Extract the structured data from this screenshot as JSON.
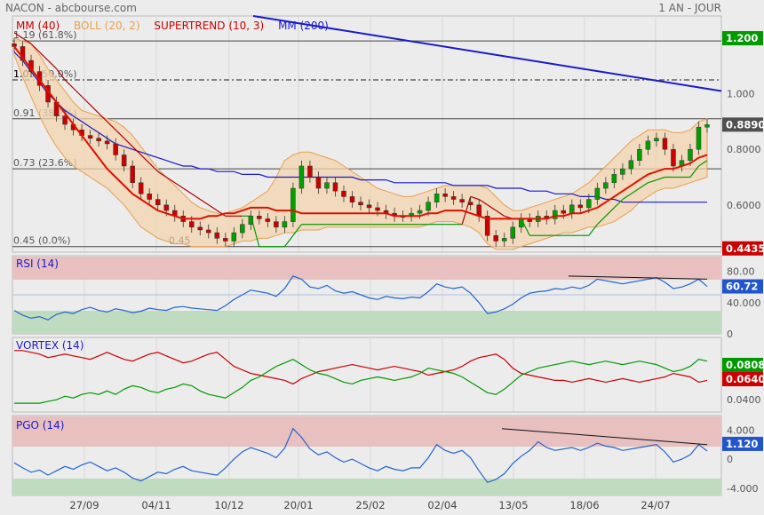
{
  "header": {
    "left": "NACON - abcbourse.com",
    "right": "1 AN - JOUR"
  },
  "legend": [
    {
      "label": "MM (40)",
      "color": "#cc0000"
    },
    {
      "label": "BOLL (20, 2)",
      "color": "#e8a050"
    },
    {
      "label": "SUPERTREND (10, 3)",
      "color": "#cc0000"
    },
    {
      "label": "MM (200)",
      "color": "#1a1acc"
    }
  ],
  "x_tick_labels": [
    "27/09",
    "04/11",
    "10/12",
    "20/01",
    "25/02",
    "02/04",
    "13/05",
    "18/06",
    "24/07"
  ],
  "main_panel": {
    "fib_levels": [
      {
        "label": "1.19  (61.8%)",
        "value": 1.19
      },
      {
        "label": "1.05  (50.0%)",
        "value": 1.05
      },
      {
        "label": "0.91  (38.2%)",
        "value": 0.91
      },
      {
        "label": "0.73  (23.6%)",
        "value": 0.73
      },
      {
        "label": "0.45  (0.0%)",
        "value": 0.45
      }
    ],
    "annotations": [
      {
        "text": "1.05",
        "x": 3,
        "y": 1.05
      },
      {
        "text": "0.45",
        "x": 60,
        "y": 0.45
      }
    ],
    "y_ticks": [
      "1.000",
      "0.8000",
      "0.6000"
    ],
    "badges": [
      {
        "text": "1.200",
        "value": 1.2,
        "color": "#009900"
      },
      {
        "text": "0.8890",
        "value": 0.889,
        "color": "#505050"
      },
      {
        "text": "0.4435",
        "value": 0.4435,
        "color": "#cc0000"
      }
    ]
  },
  "rsi_panel": {
    "title": "RSI (14)",
    "y_ticks": [
      "80.00",
      "40.000",
      "0"
    ],
    "badge": "60.72",
    "badge_color": "#2255cc"
  },
  "vortex_panel": {
    "title": "VORTEX (14)",
    "y_ticks": [
      "0.0400"
    ],
    "badges": [
      {
        "text": "0.0808",
        "color": "#009900"
      },
      {
        "text": "0.0640",
        "color": "#cc0000"
      }
    ]
  },
  "pgo_panel": {
    "title": "PGO (14)",
    "y_ticks": [
      "4.000",
      "0",
      "-4.000"
    ],
    "badge": "1.120",
    "badge_color": "#2255cc"
  },
  "colors": {
    "price_up": "#00a000",
    "price_down": "#cc0000",
    "ma40": "#dd1100",
    "ma200": "#1a1acc",
    "bollinger": "#e8a050",
    "rsi": "#2266cc",
    "zone_high": "#e8c0c0",
    "zone_low": "#c0dcc0"
  },
  "chart_data": [
    {
      "type": "candlestick",
      "title": "NACON",
      "x_tick_labels": [
        "27/09",
        "04/11",
        "10/12",
        "20/01",
        "25/02",
        "02/04",
        "13/05",
        "18/06",
        "24/07"
      ],
      "ylim": [
        0.43,
        1.28
      ],
      "series": [
        {
          "name": "NACON",
          "kind": "close",
          "values": [
            1.17,
            1.12,
            1.08,
            1.03,
            0.97,
            0.92,
            0.89,
            0.87,
            0.85,
            0.84,
            0.83,
            0.82,
            0.78,
            0.74,
            0.68,
            0.64,
            0.62,
            0.6,
            0.58,
            0.56,
            0.54,
            0.52,
            0.51,
            0.5,
            0.48,
            0.47,
            0.5,
            0.53,
            0.56,
            0.55,
            0.54,
            0.52,
            0.54,
            0.66,
            0.74,
            0.7,
            0.66,
            0.68,
            0.65,
            0.63,
            0.61,
            0.6,
            0.59,
            0.58,
            0.57,
            0.56,
            0.56,
            0.57,
            0.58,
            0.61,
            0.64,
            0.63,
            0.62,
            0.61,
            0.6,
            0.56,
            0.49,
            0.47,
            0.48,
            0.52,
            0.55,
            0.54,
            0.56,
            0.55,
            0.58,
            0.57,
            0.6,
            0.59,
            0.62,
            0.66,
            0.68,
            0.71,
            0.73,
            0.76,
            0.8,
            0.83,
            0.84,
            0.8,
            0.74,
            0.76,
            0.8,
            0.88,
            0.889
          ]
        },
        {
          "name": "MM (40)",
          "values": [
            1.17,
            1.13,
            1.09,
            1.05,
            1.01,
            0.97,
            0.93,
            0.89,
            0.85,
            0.81,
            0.77,
            0.73,
            0.7,
            0.67,
            0.64,
            0.62,
            0.6,
            0.58,
            0.57,
            0.56,
            0.55,
            0.55,
            0.55,
            0.56,
            0.56,
            0.57,
            0.57,
            0.58,
            0.59,
            0.59,
            0.59,
            0.58,
            0.58,
            0.58,
            0.57,
            0.57,
            0.57,
            0.57,
            0.57,
            0.57,
            0.57,
            0.57,
            0.57,
            0.57,
            0.57,
            0.56,
            0.56,
            0.56,
            0.56,
            0.57,
            0.57,
            0.58,
            0.58,
            0.58,
            0.57,
            0.56,
            0.55,
            0.55,
            0.55,
            0.55,
            0.55,
            0.55,
            0.55,
            0.55,
            0.56,
            0.56,
            0.57,
            0.57,
            0.58,
            0.59,
            0.61,
            0.63,
            0.65,
            0.67,
            0.69,
            0.71,
            0.72,
            0.73,
            0.73,
            0.74,
            0.75,
            0.77,
            0.78
          ]
        },
        {
          "name": "MM (200)",
          "values": [
            1.15,
            1.12,
            1.08,
            1.04,
            1.0,
            0.97,
            0.94,
            0.92,
            0.9,
            0.88,
            0.86,
            0.84,
            0.82,
            0.81,
            0.8,
            0.79,
            0.78,
            0.77,
            0.76,
            0.75,
            0.74,
            0.74,
            0.73,
            0.73,
            0.72,
            0.72,
            0.72,
            0.71,
            0.71,
            0.71,
            0.7,
            0.7,
            0.7,
            0.7,
            0.7,
            0.7,
            0.7,
            0.7,
            0.7,
            0.7,
            0.7,
            0.69,
            0.69,
            0.69,
            0.69,
            0.68,
            0.68,
            0.68,
            0.68,
            0.68,
            0.68,
            0.68,
            0.67,
            0.67,
            0.67,
            0.67,
            0.67,
            0.66,
            0.66,
            0.66,
            0.66,
            0.65,
            0.65,
            0.65,
            0.64,
            0.64,
            0.64,
            0.63,
            0.63,
            0.63,
            0.62,
            0.62,
            0.61,
            0.61,
            0.61,
            0.61,
            0.61,
            0.61,
            0.61,
            0.61,
            0.61,
            0.61,
            0.61
          ]
        },
        {
          "name": "BOLL (20, 2)",
          "kind": "upper",
          "values": [
            1.2,
            1.19,
            1.18,
            1.14,
            1.09,
            1.05,
            1.01,
            0.97,
            0.94,
            0.93,
            0.92,
            0.91,
            0.9,
            0.88,
            0.85,
            0.81,
            0.77,
            0.73,
            0.7,
            0.67,
            0.64,
            0.61,
            0.59,
            0.58,
            0.57,
            0.57,
            0.58,
            0.59,
            0.61,
            0.63,
            0.65,
            0.7,
            0.76,
            0.78,
            0.79,
            0.79,
            0.78,
            0.77,
            0.76,
            0.74,
            0.72,
            0.7,
            0.68,
            0.66,
            0.65,
            0.64,
            0.63,
            0.63,
            0.64,
            0.65,
            0.66,
            0.67,
            0.67,
            0.67,
            0.67,
            0.67,
            0.66,
            0.63,
            0.6,
            0.58,
            0.58,
            0.59,
            0.6,
            0.61,
            0.62,
            0.63,
            0.64,
            0.66,
            0.68,
            0.71,
            0.74,
            0.77,
            0.8,
            0.83,
            0.85,
            0.87,
            0.87,
            0.87,
            0.86,
            0.86,
            0.87,
            0.9,
            0.91
          ]
        },
        {
          "name": "BOLL (20, 2)",
          "kind": "lower",
          "values": [
            1.14,
            1.06,
            0.99,
            0.92,
            0.86,
            0.81,
            0.77,
            0.74,
            0.72,
            0.7,
            0.68,
            0.66,
            0.63,
            0.6,
            0.56,
            0.52,
            0.5,
            0.48,
            0.47,
            0.46,
            0.46,
            0.45,
            0.45,
            0.45,
            0.45,
            0.45,
            0.46,
            0.47,
            0.47,
            0.48,
            0.48,
            0.49,
            0.5,
            0.5,
            0.51,
            0.51,
            0.51,
            0.52,
            0.52,
            0.52,
            0.52,
            0.52,
            0.52,
            0.52,
            0.52,
            0.52,
            0.52,
            0.52,
            0.52,
            0.53,
            0.54,
            0.54,
            0.54,
            0.53,
            0.52,
            0.5,
            0.46,
            0.44,
            0.44,
            0.44,
            0.45,
            0.46,
            0.47,
            0.48,
            0.49,
            0.5,
            0.5,
            0.51,
            0.52,
            0.52,
            0.53,
            0.54,
            0.56,
            0.58,
            0.61,
            0.63,
            0.65,
            0.66,
            0.66,
            0.67,
            0.68,
            0.69,
            0.7
          ]
        },
        {
          "name": "SUPERTREND (10, 3)",
          "values": [
            1.22,
            1.2,
            1.18,
            1.15,
            1.12,
            1.09,
            1.05,
            1.02,
            0.99,
            0.96,
            0.93,
            0.9,
            0.87,
            0.84,
            0.81,
            0.78,
            0.75,
            0.72,
            0.7,
            0.68,
            0.66,
            0.64,
            0.62,
            0.6,
            0.58,
            0.56,
            0.56,
            0.56,
            0.56,
            0.45,
            0.45,
            0.45,
            0.45,
            0.49,
            0.53,
            0.53,
            0.53,
            0.53,
            0.53,
            0.53,
            0.53,
            0.53,
            0.53,
            0.53,
            0.53,
            0.53,
            0.53,
            0.53,
            0.53,
            0.53,
            0.53,
            0.53,
            0.53,
            0.53,
            0.63,
            0.62,
            0.6,
            0.58,
            0.56,
            0.55,
            0.55,
            0.49,
            0.49,
            0.49,
            0.49,
            0.49,
            0.49,
            0.49,
            0.49,
            0.53,
            0.56,
            0.59,
            0.62,
            0.64,
            0.66,
            0.68,
            0.69,
            0.7,
            0.7,
            0.7,
            0.7,
            0.74,
            0.76
          ]
        }
      ]
    },
    {
      "type": "line",
      "title": "RSI (14)",
      "ylim": [
        0,
        100
      ],
      "series": [
        {
          "name": "RSI (14)",
          "values": [
            30,
            24,
            20,
            22,
            18,
            25,
            28,
            26,
            31,
            34,
            30,
            28,
            32,
            30,
            27,
            29,
            33,
            31,
            30,
            34,
            35,
            33,
            32,
            31,
            30,
            36,
            44,
            50,
            56,
            54,
            52,
            48,
            58,
            74,
            70,
            60,
            58,
            62,
            55,
            52,
            54,
            50,
            46,
            44,
            48,
            46,
            45,
            47,
            46,
            54,
            64,
            60,
            58,
            60,
            52,
            40,
            26,
            28,
            32,
            38,
            46,
            52,
            54,
            55,
            58,
            57,
            60,
            58,
            62,
            70,
            68,
            66,
            64,
            66,
            68,
            70,
            72,
            66,
            58,
            60,
            64,
            70,
            60.72
          ]
        }
      ]
    },
    {
      "type": "line",
      "title": "VORTEX (14)",
      "series": [
        {
          "name": "VI+",
          "values": [
            0.6,
            0.6,
            0.6,
            0.6,
            0.62,
            0.64,
            0.68,
            0.66,
            0.7,
            0.72,
            0.7,
            0.74,
            0.7,
            0.76,
            0.8,
            0.78,
            0.74,
            0.72,
            0.76,
            0.78,
            0.82,
            0.8,
            0.74,
            0.7,
            0.68,
            0.66,
            0.72,
            0.78,
            0.86,
            0.9,
            0.96,
            1.02,
            1.06,
            1.1,
            1.04,
            0.98,
            0.94,
            0.92,
            0.88,
            0.84,
            0.82,
            0.86,
            0.88,
            0.9,
            0.88,
            0.86,
            0.88,
            0.9,
            0.94,
            1.0,
            0.98,
            0.96,
            0.94,
            0.9,
            0.84,
            0.78,
            0.72,
            0.7,
            0.76,
            0.84,
            0.92,
            0.96,
            1.0,
            1.02,
            1.04,
            1.06,
            1.08,
            1.06,
            1.04,
            1.06,
            1.08,
            1.06,
            1.04,
            1.06,
            1.08,
            1.06,
            1.04,
            1.0,
            0.96,
            0.98,
            1.02,
            1.1,
            1.08
          ]
        },
        {
          "name": "VI-",
          "values": [
            1.2,
            1.2,
            1.18,
            1.16,
            1.12,
            1.14,
            1.16,
            1.14,
            1.12,
            1.1,
            1.14,
            1.18,
            1.14,
            1.1,
            1.08,
            1.12,
            1.16,
            1.18,
            1.14,
            1.1,
            1.06,
            1.08,
            1.12,
            1.16,
            1.18,
            1.1,
            1.02,
            0.98,
            0.94,
            0.92,
            0.9,
            0.88,
            0.86,
            0.82,
            0.88,
            0.92,
            0.96,
            0.98,
            1.0,
            1.02,
            1.04,
            1.02,
            1.0,
            0.98,
            1.0,
            1.02,
            1.0,
            0.98,
            0.96,
            0.92,
            0.94,
            0.96,
            0.98,
            1.02,
            1.08,
            1.12,
            1.14,
            1.16,
            1.1,
            1.0,
            0.94,
            0.92,
            0.9,
            0.88,
            0.86,
            0.86,
            0.84,
            0.86,
            0.88,
            0.86,
            0.84,
            0.86,
            0.88,
            0.86,
            0.84,
            0.86,
            0.88,
            0.9,
            0.94,
            0.92,
            0.9,
            0.84,
            0.86
          ]
        }
      ]
    },
    {
      "type": "line",
      "title": "PGO (14)",
      "ylim": [
        -5,
        6
      ],
      "series": [
        {
          "name": "PGO (14)",
          "values": [
            -0.5,
            -1.2,
            -1.8,
            -1.5,
            -2.2,
            -1.6,
            -1.0,
            -1.4,
            -0.8,
            -0.4,
            -1.0,
            -1.6,
            -1.2,
            -1.8,
            -2.6,
            -3.0,
            -2.4,
            -1.8,
            -2.0,
            -1.4,
            -1.0,
            -1.6,
            -1.8,
            -2.0,
            -2.2,
            -1.2,
            0.0,
            1.0,
            1.6,
            1.2,
            0.8,
            0.2,
            1.5,
            4.2,
            3.0,
            1.4,
            0.6,
            1.0,
            0.2,
            -0.4,
            0.0,
            -0.6,
            -1.2,
            -1.6,
            -1.0,
            -1.4,
            -1.6,
            -1.2,
            -1.2,
            0.2,
            2.0,
            1.2,
            0.8,
            1.2,
            0.2,
            -1.6,
            -3.2,
            -2.8,
            -2.0,
            -0.6,
            0.4,
            1.2,
            2.4,
            1.6,
            1.2,
            1.4,
            1.6,
            1.2,
            1.6,
            2.2,
            1.8,
            1.6,
            1.2,
            1.4,
            1.6,
            1.8,
            2.0,
            1.0,
            -0.4,
            0.0,
            0.6,
            2.0,
            1.12
          ]
        }
      ]
    }
  ]
}
